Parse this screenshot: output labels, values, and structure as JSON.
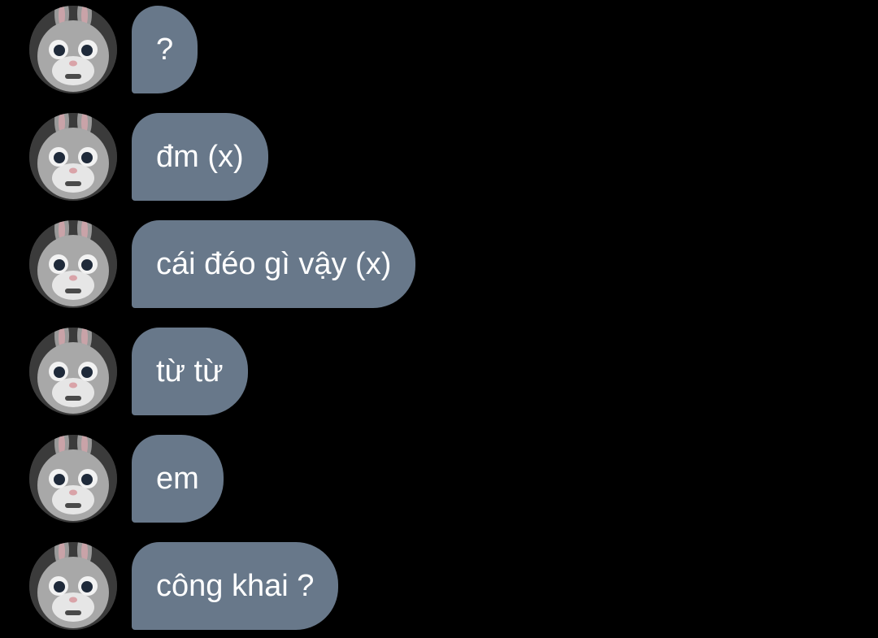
{
  "conversation": {
    "bubble_color": "#68788a",
    "text_color": "#ffffff",
    "background": "#000000",
    "avatar_icon": "bunny-mascot-avatar",
    "messages": [
      {
        "text": "?"
      },
      {
        "text": "đm (x)"
      },
      {
        "text": "cái đéo gì vậy (x)"
      },
      {
        "text": "từ từ"
      },
      {
        "text": "em"
      },
      {
        "text": "công khai ?"
      }
    ]
  }
}
